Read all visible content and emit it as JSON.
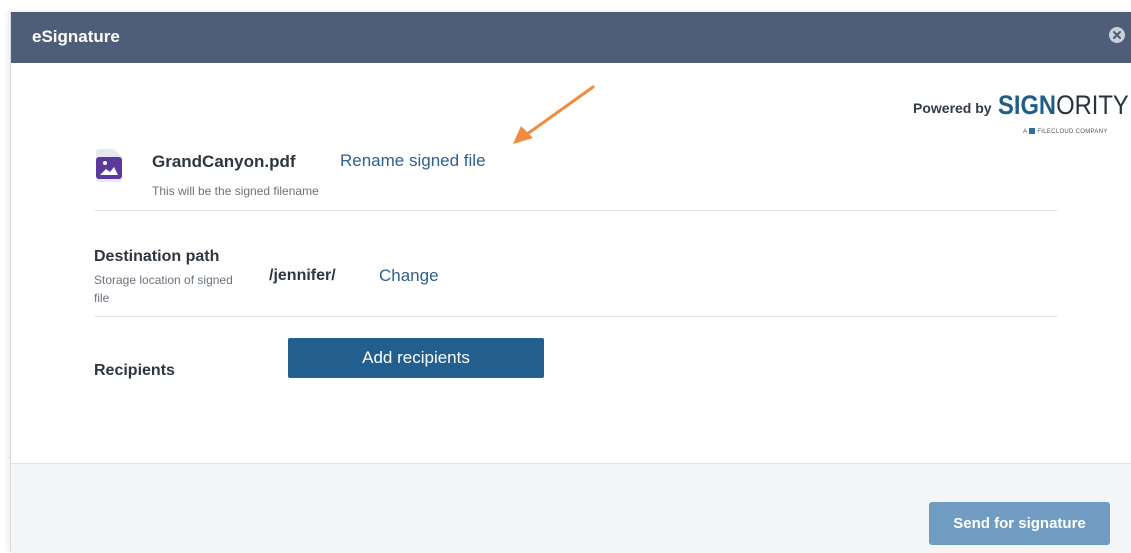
{
  "dialog": {
    "title": "eSignature",
    "close_icon": "close-circle-icon"
  },
  "branding": {
    "powered_by": "Powered by",
    "brand_strong": "SIGN",
    "brand_light": "ORITY",
    "brand_sub_prefix": "A",
    "brand_sub_company": "FILECLOUD COMPANY"
  },
  "file": {
    "icon": "image-file-icon",
    "name": "GrandCanyon.pdf",
    "rename_label": "Rename signed file",
    "hint": "This will be the signed filename"
  },
  "destination": {
    "label": "Destination path",
    "hint": "Storage location of signed file",
    "path": "/jennifer/",
    "change_label": "Change"
  },
  "recipients": {
    "label": "Recipients",
    "add_label": "Add recipients"
  },
  "footer": {
    "send_label": "Send for signature"
  },
  "colors": {
    "header_bg": "#4f5e78",
    "primary_button": "#225f8f",
    "disabled_button": "#6f9cc0",
    "link": "#2e5f8f",
    "annotation_arrow": "#f08a3c",
    "file_icon": "#5b3a9c"
  }
}
